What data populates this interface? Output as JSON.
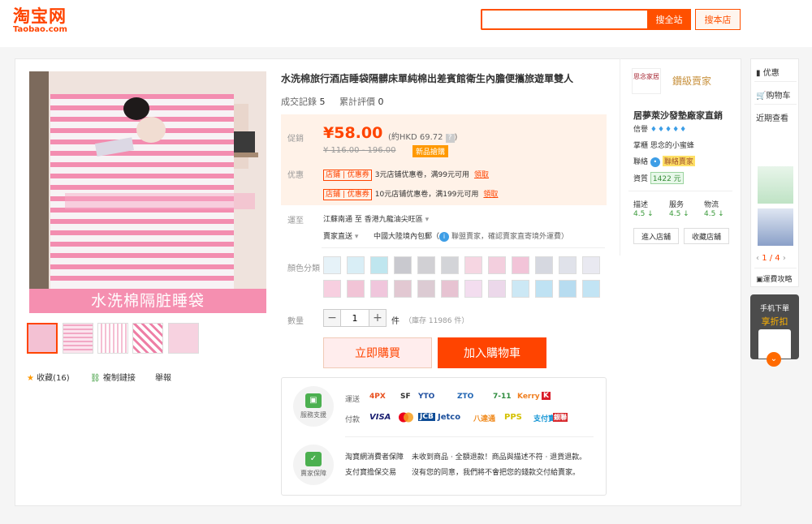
{
  "header": {
    "logo_cn": "淘宝网",
    "logo_en": "Taobao.com",
    "search_placeholder": "",
    "search_all": "搜全站",
    "search_store": "搜本店"
  },
  "product": {
    "title": "水洗棉旅行酒店睡袋隔髒床單純棉出差賓館衛生內膽便攜旅遊單雙人",
    "sales_label": "成交記錄",
    "sales_count": "5",
    "reviews_label": "累計評價",
    "reviews_count": "0",
    "image_caption": "水洗棉隔脏睡袋",
    "thumbnails": [
      "thumb-1",
      "thumb-2",
      "thumb-3",
      "thumb-4",
      "thumb-5"
    ]
  },
  "price": {
    "promo_label": "促銷",
    "current": "¥58.00",
    "hkd": "(約HKD 69.72",
    "hkd_close": ")",
    "help": "?",
    "original": "¥ 116.00 - 196.00",
    "badge": "新品搶購",
    "coupon_label": "优惠",
    "coupons": [
      {
        "tag": "店鋪 | 优惠券",
        "text": "3元店铺优惠卷，满99元可用",
        "action": "領取"
      },
      {
        "tag": "店鋪 | 优惠券",
        "text": "10元店铺优惠卷，满199元可用",
        "action": "領取"
      }
    ]
  },
  "shipping": {
    "label": "運至",
    "route": "江蘇南通 至  香港九龍油尖旺區",
    "method": "賣家直送",
    "free": "中國大陸境內包郵（",
    "guarantee": "聯盟賣家，確認賣家直寄境外運費）"
  },
  "options": {
    "color_label": "顏色分類",
    "swatch_colors": [
      "#e6f2f8",
      "#d9eef6",
      "#bfe6ef",
      "#c9c9cf",
      "#d1d0d4",
      "#d3d4d8",
      "#f6d6e2",
      "#f3cfde",
      "#f2c4d8",
      "#d6d8e0",
      "#e0e2ea",
      "#e9e9f1",
      "#f7cfe0",
      "#f1c4d6",
      "#f0c6dc",
      "#e2c8d2",
      "#dccbd3",
      "#e7c3d2",
      "#f3ddef",
      "#ecd8ea",
      "#cce8f5",
      "#bfe2f3",
      "#b7dcf0",
      "#c2e4f4"
    ],
    "qty_label": "數量",
    "qty": "1",
    "minus": "−",
    "plus": "+",
    "unit": "件",
    "stock": "（庫存 11986 件）"
  },
  "actions": {
    "buy_now": "立即購買",
    "add_cart": "加入購物車",
    "favorite": "收藏(16)",
    "copy_link": "複制鏈接",
    "report": "舉報"
  },
  "services": {
    "support_label": "服務支援",
    "shipping_label": "運送",
    "pay_label": "付款",
    "carriers": [
      "4PX",
      "SF",
      "YTO",
      "ZTO",
      "7-11",
      "Kerry",
      "K"
    ],
    "payments": [
      "VISA",
      "mastercard",
      "JCB",
      "Jetco",
      "八達通",
      "PPS",
      "支付寶",
      "銀聯"
    ],
    "guarantee_label": "賣家保障",
    "g1_title": "淘寶網消費者保障",
    "g1_text": "未收到商品 · 全額退款！商品與描述不符 · 退貨退款。",
    "g2_title": "支付寶擔保交易",
    "g2_text": "沒有您的同意，我們將不會把您的錢款交付給賣家。"
  },
  "seller": {
    "logo_text": "思念家居",
    "gold": "鑽級賣家",
    "shop_name": "居夢萊沙發墊廠家直銷",
    "credit_label": "信譽",
    "diamonds": "♦♦♦♦♦",
    "keeper_label": "掌櫃",
    "keeper": "思念的小蜜蜂",
    "contact_label": "聯絡",
    "contact": "聯絡賣家",
    "deposit_label": "資質",
    "deposit": "1422 元",
    "score_labels": [
      "描述",
      "服务",
      "物流"
    ],
    "scores": [
      "4.5 ↓",
      "4.5 ↓",
      "4.5 ↓"
    ],
    "enter_shop": "進入店舖",
    "fav_shop": "收藏店舖"
  },
  "sidebar": {
    "promo": "优惠",
    "cart": "购物车",
    "recent": "近期查看",
    "pager": "1 / 4",
    "prev": "‹",
    "next": "›",
    "shipping_calc": "運費攻略",
    "mobile_order": "手机下單",
    "mobile_discount": "享折扣"
  },
  "colors": {
    "brand": "#ff4400",
    "price_bg": "#fff2e8"
  }
}
